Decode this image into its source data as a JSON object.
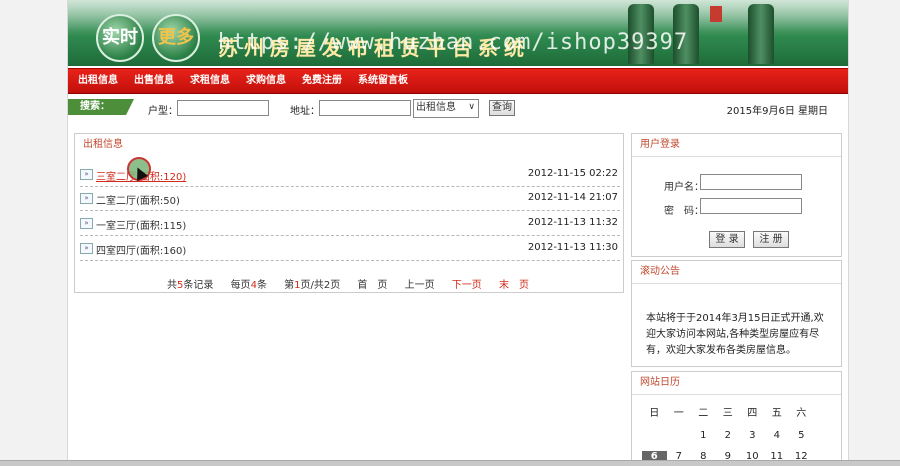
{
  "banner": {
    "bubble1": "实时",
    "bubble2": "更多",
    "title": "苏州房屋发布租赁平台系统",
    "watermark": "https://www.huzhan.com/ishop39397"
  },
  "nav": [
    "出租信息",
    "出售信息",
    "求租信息",
    "求购信息",
    "免费注册",
    "系统留言板"
  ],
  "search": {
    "tag": "搜索：",
    "room_type_label": "户型：",
    "address_label": "地址：",
    "select_value": "出租信息",
    "query_button": "查询",
    "date": "2015年9月6日 星期日"
  },
  "rentals": {
    "title": "出租信息",
    "items": [
      {
        "title": "三室二厅(面积:120)",
        "time": "2012-11-15 02:22"
      },
      {
        "title": "二室二厅(面积:50)",
        "time": "2012-11-14 21:07"
      },
      {
        "title": "一室三厅(面积:115)",
        "time": "2012-11-13 11:32"
      },
      {
        "title": "四室四厅(面积:160)",
        "time": "2012-11-13 11:30"
      }
    ],
    "pager": {
      "total_prefix": "共",
      "total_count": "5",
      "total_suffix": "条记录",
      "per_prefix": "每页",
      "per_count": "4",
      "per_suffix": "条",
      "page_prefix": "第",
      "page_current": "1",
      "page_suffix": "页/共2页",
      "first": "首　页",
      "prev": "上一页",
      "next": "下一页",
      "last": "末　页"
    }
  },
  "login": {
    "title": "用户登录",
    "username_label": "用户名：",
    "password_label": "密　码：",
    "login_button": "登 录",
    "register_button": "注 册"
  },
  "notice": {
    "title": "滚动公告",
    "text": "本站将于于2014年3月15日正式开通,欢迎大家访问本网站,各种类型房屋应有尽有，欢迎大家发布各类房屋信息。"
  },
  "calendar": {
    "title": "网站日历",
    "weekdays": [
      "日",
      "一",
      "二",
      "三",
      "四",
      "五",
      "六"
    ],
    "rows": [
      [
        "",
        "",
        "1",
        "2",
        "3",
        "4",
        "5"
      ],
      [
        "6",
        "7",
        "8",
        "9",
        "10",
        "11",
        "12"
      ]
    ],
    "today": "6"
  }
}
